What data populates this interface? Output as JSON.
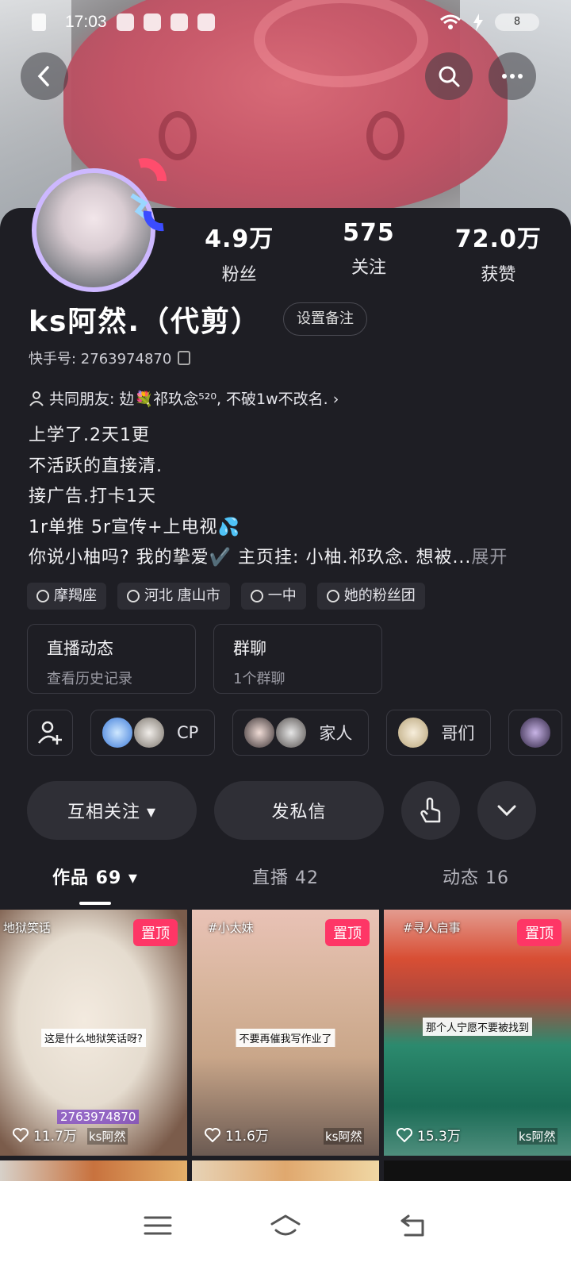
{
  "status_bar": {
    "time": "17:03",
    "battery": "8"
  },
  "profile": {
    "stats": [
      {
        "value": "4.9万",
        "label": "粉丝"
      },
      {
        "value": "575",
        "label": "关注"
      },
      {
        "value": "72.0万",
        "label": "获赞"
      }
    ],
    "name": "ks阿然.（代剪）",
    "remark_button": "设置备注",
    "kuaishou_id": "快手号: 2763974870",
    "mutual_friends": "共同朋友: 攰💐祁玖念⁵²⁰, 不破1w不改名. ›",
    "bio_lines": [
      "上学了.2天1更",
      "不活跃的直接清.",
      "接广告.打卡1天",
      "1r单推 5r宣传+上电视💦",
      "你说小柚吗? 我的挚爱✔️ 主页挂: 小柚.祁玖念. 想被..."
    ],
    "expand": "展开",
    "tags": [
      "摩羯座",
      "河北 唐山市",
      "一中",
      "她的粉丝团"
    ]
  },
  "boxes": [
    {
      "title": "直播动态",
      "subtitle": "查看历史记录"
    },
    {
      "title": "群聊",
      "subtitle": "1个群聊"
    }
  ],
  "groups": [
    "CP",
    "家人",
    "哥们"
  ],
  "actions": {
    "follow": "互相关注 ▾",
    "message": "发私信"
  },
  "tabs": [
    "作品 69 ▾",
    "直播 42",
    "动态 16"
  ],
  "videos": [
    {
      "pinned": "置顶",
      "tag": "地狱笑话",
      "caption": "这是什么地狱笑话呀?",
      "likes": "11.7万",
      "author": "ks阿然",
      "id_text": "2763974870"
    },
    {
      "pinned": "置顶",
      "tag": "#小太妹",
      "caption": "不要再催我写作业了",
      "likes": "11.6万",
      "author": "ks阿然"
    },
    {
      "pinned": "置顶",
      "tag": "#寻人启事",
      "caption": "那个人宁愿不要被找到",
      "likes": "15.3万",
      "author": "ks阿然"
    }
  ]
}
